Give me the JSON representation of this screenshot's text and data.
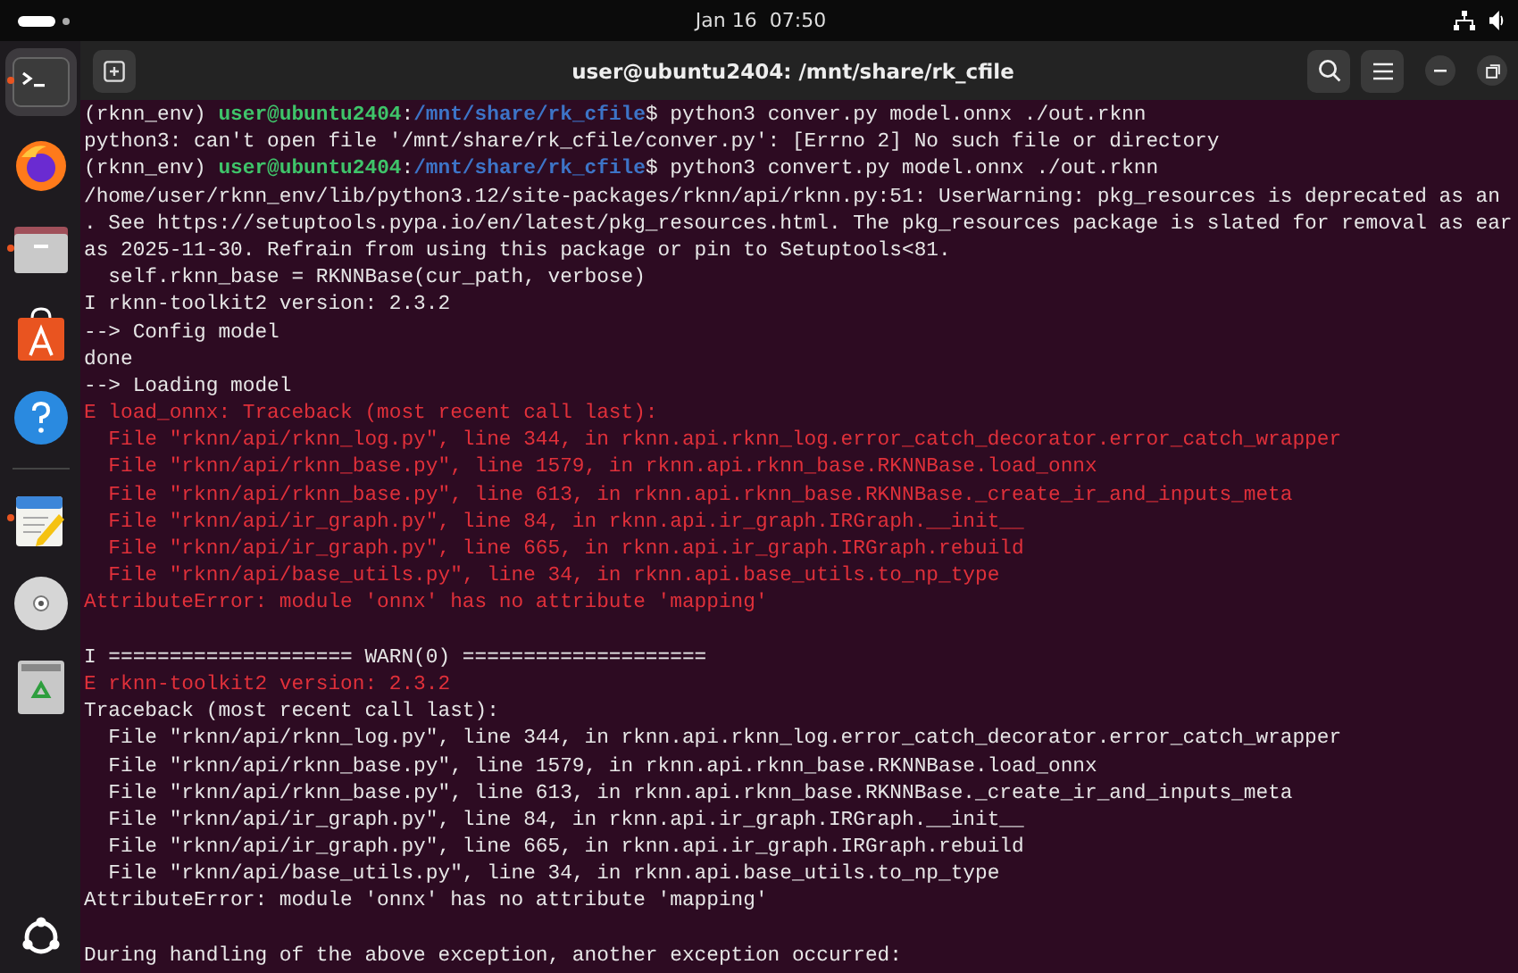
{
  "top_bar": {
    "date": "Jan 16",
    "time": "07:50"
  },
  "dock": {
    "groups": [
      {
        "items": [
          {
            "kind": "terminal",
            "running": true,
            "selected": true
          },
          {
            "kind": "browser",
            "running": false,
            "selected": false
          },
          {
            "kind": "files",
            "running": true,
            "selected": false
          },
          {
            "kind": "store",
            "running": false,
            "selected": false
          },
          {
            "kind": "help",
            "running": false,
            "selected": false
          }
        ]
      },
      {
        "items": [
          {
            "kind": "editor",
            "running": true,
            "selected": false
          },
          {
            "kind": "disc",
            "running": false,
            "selected": false
          },
          {
            "kind": "trash",
            "running": false,
            "selected": false
          }
        ]
      }
    ]
  },
  "window": {
    "title": "user@ubuntu2404: /mnt/share/rk_cfile"
  },
  "terminal": {
    "lines": [
      {
        "kind": "prompt",
        "env": "(rknn_env)",
        "user": "user@ubuntu2404",
        "colon": ":",
        "path": "/mnt/share/rk_cfile",
        "command": "$ python3 conver.py model.onnx ./out.rknn"
      },
      {
        "kind": "normal",
        "text": "python3: can't open file '/mnt/share/rk_cfile/conver.py': [Errno 2] No such file or directory"
      },
      {
        "kind": "prompt",
        "env": "(rknn_env)",
        "user": "user@ubuntu2404",
        "colon": ":",
        "path": "/mnt/share/rk_cfile",
        "command": "$ python3 convert.py model.onnx ./out.rknn"
      },
      {
        "kind": "normal",
        "text": "/home/user/rknn_env/lib/python3.12/site-packages/rknn/api/rknn.py:51: UserWarning: pkg_resources is deprecated as an"
      },
      {
        "kind": "normal",
        "text": ". See https://setuptools.pypa.io/en/latest/pkg_resources.html. The pkg_resources package is slated for removal as ear"
      },
      {
        "kind": "normal",
        "text": "as 2025-11-30. Refrain from using this package or pin to Setuptools<81."
      },
      {
        "kind": "normal",
        "text": "  self.rknn_base = RKNNBase(cur_path, verbose)"
      },
      {
        "kind": "normal",
        "text": "I rknn-toolkit2 version: 2.3.2"
      },
      {
        "kind": "normal",
        "text": "--> Config model"
      },
      {
        "kind": "normal",
        "text": "done"
      },
      {
        "kind": "normal",
        "text": "--> Loading model"
      },
      {
        "kind": "error",
        "text": "E load_onnx: Traceback (most recent call last):"
      },
      {
        "kind": "error",
        "text": "  File \"rknn/api/rknn_log.py\", line 344, in rknn.api.rknn_log.error_catch_decorator.error_catch_wrapper"
      },
      {
        "kind": "error",
        "text": "  File \"rknn/api/rknn_base.py\", line 1579, in rknn.api.rknn_base.RKNNBase.load_onnx"
      },
      {
        "kind": "error",
        "text": "  File \"rknn/api/rknn_base.py\", line 613, in rknn.api.rknn_base.RKNNBase._create_ir_and_inputs_meta"
      },
      {
        "kind": "error",
        "text": "  File \"rknn/api/ir_graph.py\", line 84, in rknn.api.ir_graph.IRGraph.__init__"
      },
      {
        "kind": "error",
        "text": "  File \"rknn/api/ir_graph.py\", line 665, in rknn.api.ir_graph.IRGraph.rebuild"
      },
      {
        "kind": "error",
        "text": "  File \"rknn/api/base_utils.py\", line 34, in rknn.api.base_utils.to_np_type"
      },
      {
        "kind": "error",
        "text": "AttributeError: module 'onnx' has no attribute 'mapping'"
      },
      {
        "kind": "blank"
      },
      {
        "kind": "normal",
        "text": "I ==================== WARN(0) ===================="
      },
      {
        "kind": "error",
        "text": "E rknn-toolkit2 version: 2.3.2"
      },
      {
        "kind": "normal",
        "text": "Traceback (most recent call last):"
      },
      {
        "kind": "normal",
        "text": "  File \"rknn/api/rknn_log.py\", line 344, in rknn.api.rknn_log.error_catch_decorator.error_catch_wrapper"
      },
      {
        "kind": "normal",
        "text": "  File \"rknn/api/rknn_base.py\", line 1579, in rknn.api.rknn_base.RKNNBase.load_onnx"
      },
      {
        "kind": "normal",
        "text": "  File \"rknn/api/rknn_base.py\", line 613, in rknn.api.rknn_base.RKNNBase._create_ir_and_inputs_meta"
      },
      {
        "kind": "normal",
        "text": "  File \"rknn/api/ir_graph.py\", line 84, in rknn.api.ir_graph.IRGraph.__init__"
      },
      {
        "kind": "normal",
        "text": "  File \"rknn/api/ir_graph.py\", line 665, in rknn.api.ir_graph.IRGraph.rebuild"
      },
      {
        "kind": "normal",
        "text": "  File \"rknn/api/base_utils.py\", line 34, in rknn.api.base_utils.to_np_type"
      },
      {
        "kind": "normal",
        "text": "AttributeError: module 'onnx' has no attribute 'mapping'"
      },
      {
        "kind": "blank"
      },
      {
        "kind": "normal",
        "text": "During handling of the above exception, another exception occurred:"
      }
    ]
  }
}
